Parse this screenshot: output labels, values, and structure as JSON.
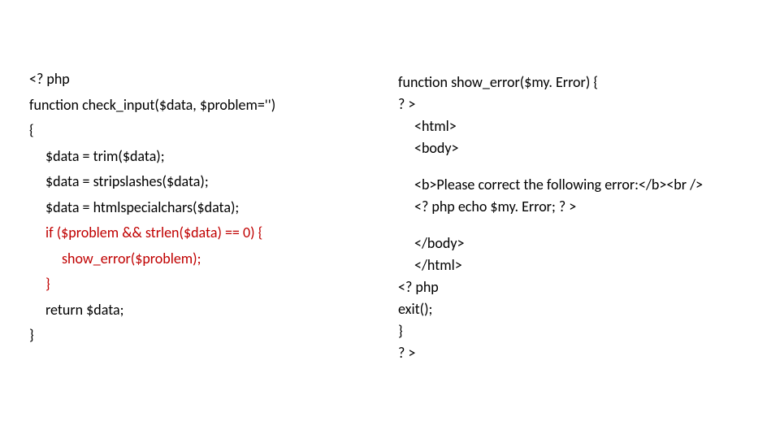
{
  "left": {
    "l1": "<? php",
    "l2": "function check_input($data, $problem='')",
    "l3": "{",
    "l4": "$data = trim($data);",
    "l5": "$data = stripslashes($data);",
    "l6": "$data = htmlspecialchars($data);",
    "l7": "if ($problem && strlen($data) == 0)   {",
    "l8": "show_error($problem);",
    "l9": "}",
    "l10": "return $data;",
    "l11": "}"
  },
  "right": {
    "r1": "function show_error($my. Error) {",
    "r2": "? >",
    "r3": "<html>",
    "r4": "<body>",
    "r5": "<b>Please correct the following error:</b><br />",
    "r6": "<? php echo $my. Error; ? >",
    "r7": "</body>",
    "r8": "</html>",
    "r9": "<? php",
    "r10": "exit();",
    "r11": "}",
    "r12": "? >"
  }
}
